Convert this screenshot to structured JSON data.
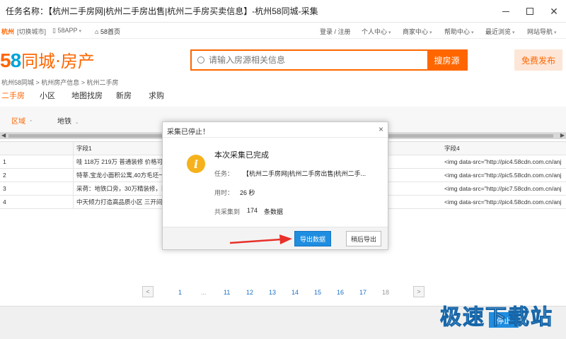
{
  "window": {
    "title": "任务名称：【杭州二手房网|杭州二手房出售|杭州二手房买卖信息】-杭州58同城-采集"
  },
  "site_top": {
    "city": "杭州",
    "switch": "[切换城市]",
    "app": "58APP",
    "home": "58首页",
    "nav": [
      "登录 / 注册",
      "个人中心",
      "商家中心",
      "帮助中心",
      "最近浏览",
      "网站导航"
    ]
  },
  "logo": {
    "digit1": "5",
    "digit2": "8",
    "text": "同城·房产"
  },
  "search": {
    "placeholder": "请输入房源相关信息",
    "button": "搜房源"
  },
  "post_button": "免费发布",
  "breadcrumb": "杭州58同城 > 杭州房产信息 > 杭州二手房",
  "nav_tabs": [
    "二手房",
    "小区",
    "地图找房",
    "新房",
    "求购"
  ],
  "filters": [
    "区域",
    "地铁"
  ],
  "table": {
    "headers": [
      "",
      "字段1",
      "字段4"
    ],
    "rows": [
      [
        "1",
        "哇 118万 219万 普通装修 价格可议",
        "<img data-src=\"http://pic4.58cdn.com.cn/anj"
      ],
      [
        "2",
        "特莘,宝龙小面积公寓,40方毛坯一口",
        "<img data-src=\"http://pic5.58cdn.com.cn/anj"
      ],
      [
        "3",
        "采荷：地铁口旁，30万精装修，两",
        "<img data-src=\"http://pic7.58cdn.com.cn/anj"
      ],
      [
        "4",
        "中天倾力打造高品质小区 三开间朝",
        "<img data-src=\"http://pic4.58cdn.com.cn/anj"
      ]
    ]
  },
  "pager": {
    "prev": "<",
    "next": ">",
    "pages": [
      "1",
      "...",
      "11",
      "12",
      "13",
      "14",
      "15",
      "16",
      "17",
      "18"
    ],
    "current": "18"
  },
  "bottom": {
    "button": "停止"
  },
  "watermark": "极速下载站",
  "dialog": {
    "title": "采集已停止！",
    "close": "×",
    "main": "本次采集已完成",
    "task_label": "任务：",
    "task_value": "【杭州二手房网|杭州二手房出售|杭州二手...",
    "time_label": "用时：",
    "time_value": "26 秒",
    "count_label": "共采集到",
    "count_value": "174",
    "count_unit": "条数据",
    "export_button": "导出数据",
    "later_button": "稍后导出"
  },
  "colors": {
    "brand_orange": "#ff6600",
    "dialog_blue": "#1f8de0",
    "info_yellow": "#f5b21c",
    "arrow_red": "#e8302a"
  }
}
